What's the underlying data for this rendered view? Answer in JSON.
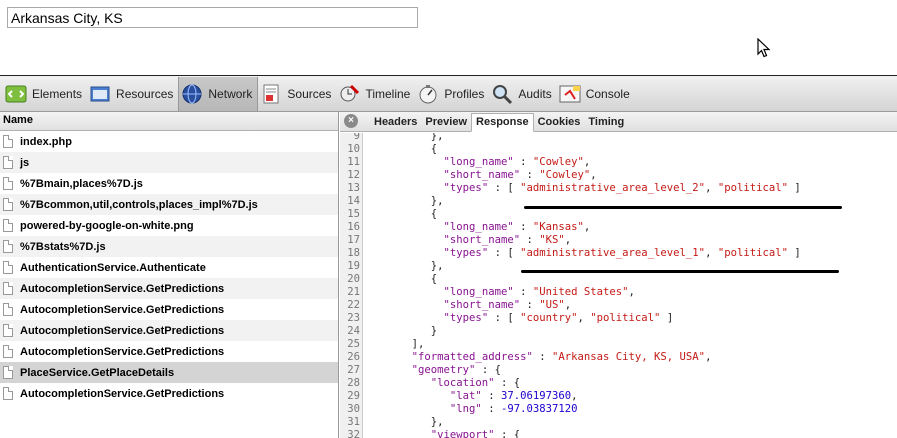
{
  "page": {
    "search_value": "Arkansas City, KS"
  },
  "toolbar": {
    "items": [
      {
        "label": "Elements",
        "icon": "elements-icon"
      },
      {
        "label": "Resources",
        "icon": "resources-icon"
      },
      {
        "label": "Network",
        "icon": "network-icon",
        "active": true
      },
      {
        "label": "Sources",
        "icon": "sources-icon"
      },
      {
        "label": "Timeline",
        "icon": "timeline-icon"
      },
      {
        "label": "Profiles",
        "icon": "profiles-icon"
      },
      {
        "label": "Audits",
        "icon": "audits-icon"
      },
      {
        "label": "Console",
        "icon": "console-icon"
      }
    ]
  },
  "requests": {
    "header": "Name",
    "items": [
      "index.php",
      "js",
      "%7Bmain,places%7D.js",
      "%7Bcommon,util,controls,places_impl%7D.js",
      "powered-by-google-on-white.png",
      "%7Bstats%7D.js",
      "AuthenticationService.Authenticate",
      "AutocompletionService.GetPredictions",
      "AutocompletionService.GetPredictions",
      "AutocompletionService.GetPredictions",
      "AutocompletionService.GetPredictions",
      "PlaceService.GetPlaceDetails",
      "AutocompletionService.GetPredictions"
    ],
    "selected_index": 11
  },
  "detail_tabs": {
    "close_glyph": "×",
    "items": [
      "Headers",
      "Preview",
      "Response",
      "Cookies",
      "Timing"
    ],
    "active": "Response"
  },
  "response": {
    "lines": [
      {
        "n": "9",
        "t": "          },"
      },
      {
        "n": "10",
        "t": "          {"
      },
      {
        "n": "11",
        "t": "            \"long_name\" : \"Cowley\","
      },
      {
        "n": "12",
        "t": "            \"short_name\" : \"Cowley\","
      },
      {
        "n": "13",
        "t": "            \"types\" : [ \"administrative_area_level_2\", \"political\" ]"
      },
      {
        "n": "14",
        "t": "          },"
      },
      {
        "n": "15",
        "t": "          {"
      },
      {
        "n": "16",
        "t": "            \"long_name\" : \"Kansas\","
      },
      {
        "n": "17",
        "t": "            \"short_name\" : \"KS\","
      },
      {
        "n": "18",
        "t": "            \"types\" : [ \"administrative_area_level_1\", \"political\" ]"
      },
      {
        "n": "19",
        "t": "          },"
      },
      {
        "n": "20",
        "t": "          {"
      },
      {
        "n": "21",
        "t": "            \"long_name\" : \"United States\","
      },
      {
        "n": "22",
        "t": "            \"short_name\" : \"US\","
      },
      {
        "n": "23",
        "t": "            \"types\" : [ \"country\", \"political\" ]"
      },
      {
        "n": "24",
        "t": "          }"
      },
      {
        "n": "25",
        "t": "       ],"
      },
      {
        "n": "26",
        "t": "       \"formatted_address\" : \"Arkansas City, KS, USA\","
      },
      {
        "n": "27",
        "t": "       \"geometry\" : {"
      },
      {
        "n": "28",
        "t": "          \"location\" : {"
      },
      {
        "n": "29",
        "t": "             \"lat\" : 37.06197360,"
      },
      {
        "n": "30",
        "t": "             \"lng\" : -97.03837120"
      },
      {
        "n": "31",
        "t": "          },"
      },
      {
        "n": "32",
        "t": "          \"viewport\" : {"
      }
    ]
  },
  "colors": {
    "key": "#881391",
    "string": "#c41a16",
    "number": "#1c00cf",
    "selected_row": "#d4d4d4"
  }
}
